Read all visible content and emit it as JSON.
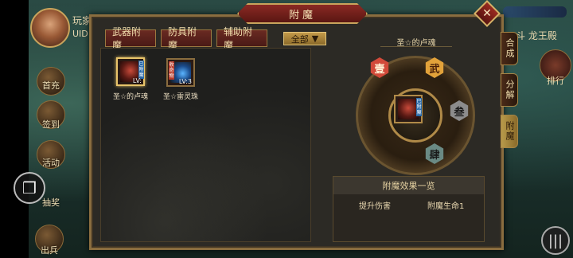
{
  "dialog": {
    "title": "附魔",
    "close_label": "✕"
  },
  "tabs": [
    {
      "label": "武器附魔"
    },
    {
      "label": "防具附魔"
    },
    {
      "label": "辅助附魔"
    }
  ],
  "filter": {
    "label": "全部",
    "arrow": "▼"
  },
  "items": [
    {
      "name": "圣☆的卢魂",
      "level": "LV:",
      "tag": "已附魔",
      "art": "red"
    },
    {
      "name": "圣☆雷灵珠",
      "level": "LV:3",
      "tag": "收奇物",
      "art": "blue"
    }
  ],
  "enchant": {
    "item_name": "圣☆的卢魂",
    "center_tag": "已附魔",
    "badges": [
      {
        "glyph": "壹",
        "color": "red"
      },
      {
        "glyph": "武",
        "color": "gold"
      },
      {
        "glyph": "叁",
        "color": "grey"
      },
      {
        "glyph": "肆",
        "color": "teal"
      }
    ]
  },
  "effects": {
    "title": "附魔效果一览",
    "items": [
      "提升伤害",
      "附魔生命1"
    ]
  },
  "side_tabs": [
    {
      "label": "合成",
      "active": false
    },
    {
      "label": "分解",
      "active": false
    },
    {
      "label": "附魔",
      "active": true
    }
  ],
  "background": {
    "player_name": "玩家",
    "player_uid": "UID",
    "left_icons": [
      "首充",
      "签到",
      "活动",
      "抽奖",
      "出兵"
    ],
    "right_title": "斗 龙王殿",
    "right_icon_label": "排行",
    "float_icon": "cube-icon",
    "menu_icon": "|||"
  },
  "colors": {
    "title_red": "#8a2a24",
    "gold_border": "#8a6d3f",
    "panel_dark": "#1f1f1d",
    "text_cream": "#e9dcc0"
  }
}
